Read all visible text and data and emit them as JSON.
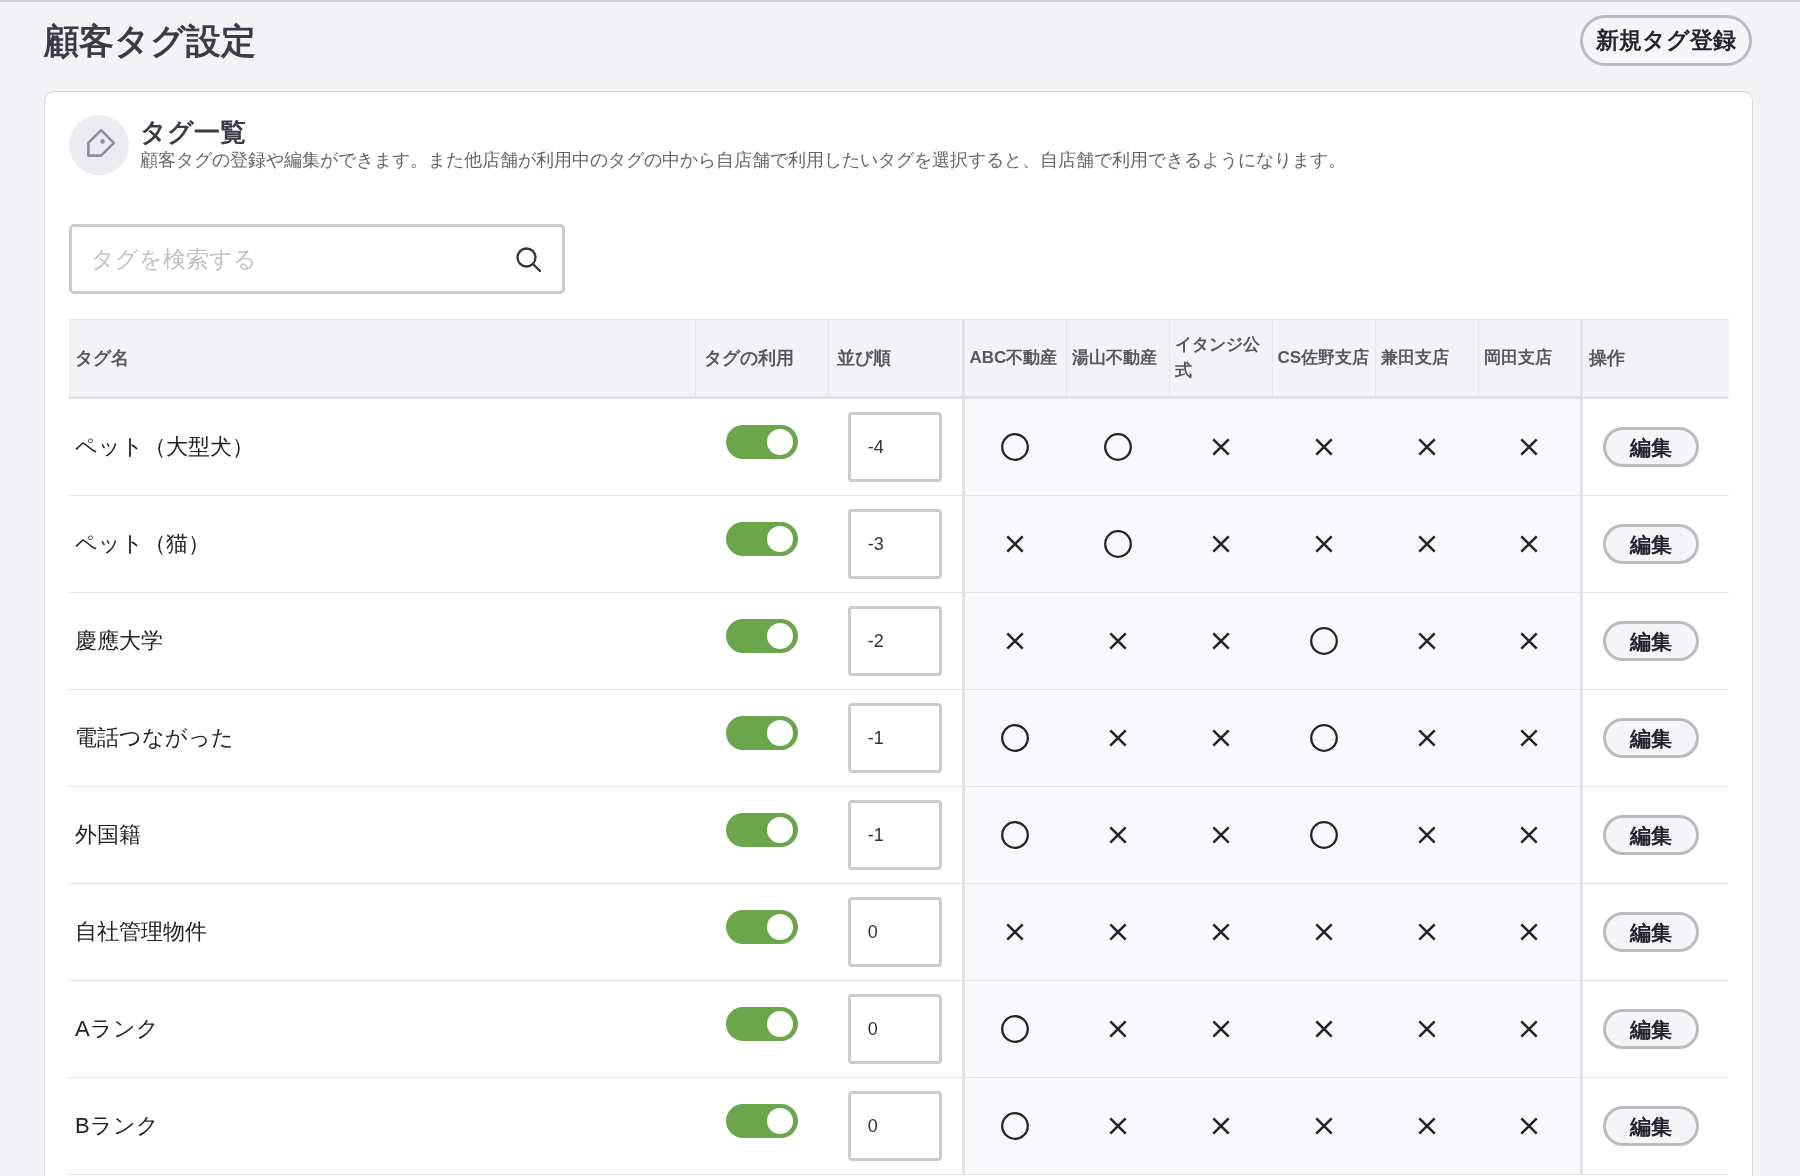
{
  "page": {
    "title": "顧客タグ設定",
    "new_tag_button": "新規タグ登録"
  },
  "panel": {
    "title": "タグ一覧",
    "description": "顧客タグの登録や編集ができます。また他店舗が利用中のタグの中から自店舗で利用したいタグを選択すると、自店舗で利用できるようになります。"
  },
  "search": {
    "placeholder": "タグを検索する"
  },
  "table": {
    "columns": [
      {
        "label": "タグ名",
        "kind": "name"
      },
      {
        "label": "タグの利用",
        "kind": "toggle"
      },
      {
        "label": "並び順",
        "kind": "order"
      },
      {
        "label": "ABC不動産",
        "kind": "store"
      },
      {
        "label": "湯山不動産",
        "kind": "store"
      },
      {
        "label": "イタンジ公式",
        "kind": "store"
      },
      {
        "label": "CS佐野支店",
        "kind": "store"
      },
      {
        "label": "兼田支店",
        "kind": "store"
      },
      {
        "label": "岡田支店",
        "kind": "store"
      },
      {
        "label": "操作",
        "kind": "action"
      }
    ],
    "rows": [
      {
        "name": "ペット（大型犬）",
        "on": true,
        "order": "-4",
        "stores": [
          {
            "used": true
          },
          {
            "used": true
          },
          {
            "used": false
          },
          {
            "used": false
          },
          {
            "used": false
          },
          {
            "used": false
          }
        ],
        "action": "編集"
      },
      {
        "name": "ペット（猫）",
        "on": true,
        "order": "-3",
        "stores": [
          {
            "used": false
          },
          {
            "used": true
          },
          {
            "used": false
          },
          {
            "used": false
          },
          {
            "used": false
          },
          {
            "used": false
          }
        ],
        "action": "編集"
      },
      {
        "name": "慶應大学",
        "on": true,
        "order": "-2",
        "stores": [
          {
            "used": false
          },
          {
            "used": false
          },
          {
            "used": false
          },
          {
            "used": true
          },
          {
            "used": false
          },
          {
            "used": false
          }
        ],
        "action": "編集"
      },
      {
        "name": "電話つながった",
        "on": true,
        "order": "-1",
        "stores": [
          {
            "used": true
          },
          {
            "used": false
          },
          {
            "used": false
          },
          {
            "used": true
          },
          {
            "used": false
          },
          {
            "used": false
          }
        ],
        "action": "編集"
      },
      {
        "name": "外国籍",
        "on": true,
        "order": "-1",
        "stores": [
          {
            "used": true
          },
          {
            "used": false
          },
          {
            "used": false
          },
          {
            "used": true
          },
          {
            "used": false
          },
          {
            "used": false
          }
        ],
        "action": "編集"
      },
      {
        "name": "自社管理物件",
        "on": true,
        "order": "0",
        "stores": [
          {
            "used": false
          },
          {
            "used": false
          },
          {
            "used": false
          },
          {
            "used": false
          },
          {
            "used": false
          },
          {
            "used": false
          }
        ],
        "action": "編集"
      },
      {
        "name": "Aランク",
        "on": true,
        "order": "0",
        "stores": [
          {
            "used": true
          },
          {
            "used": false
          },
          {
            "used": false
          },
          {
            "used": false
          },
          {
            "used": false
          },
          {
            "used": false
          }
        ],
        "action": "編集"
      },
      {
        "name": "Bランク",
        "on": true,
        "order": "0",
        "stores": [
          {
            "used": true
          },
          {
            "used": false
          },
          {
            "used": false
          },
          {
            "used": false
          },
          {
            "used": false
          },
          {
            "used": false
          }
        ],
        "action": "編集"
      }
    ]
  }
}
